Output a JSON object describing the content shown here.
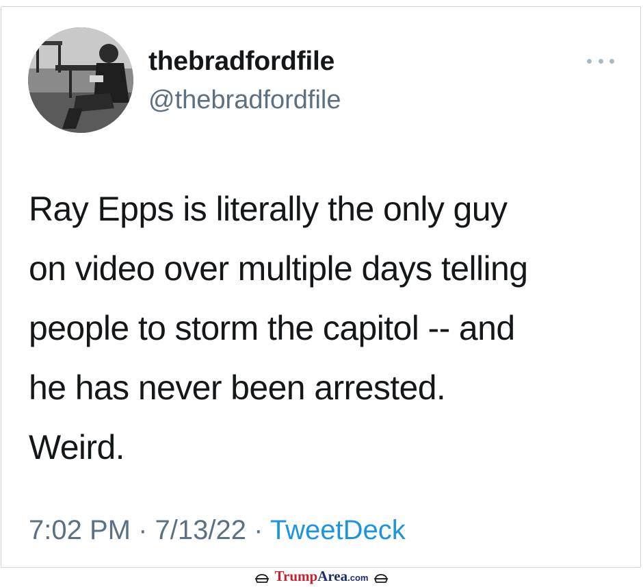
{
  "tweet": {
    "display_name": "thebradfordfile",
    "handle": "@thebradfordfile",
    "text": "Ray Epps is literally the only guy\non video over multiple days telling\npeople to storm the capitol -- and\nhe has never been arrested.\nWeird.",
    "time": "7:02 PM",
    "date": "7/13/22",
    "source": "TweetDeck",
    "separator": "·"
  },
  "icons": {
    "more": "more-horizontal-icon",
    "watermark_left": "hat-icon",
    "watermark_right": "hat-icon"
  },
  "watermark": {
    "brand_part1": "Trump",
    "brand_part2": "Area",
    "brand_part3": ".com"
  },
  "colors": {
    "handle": "#5b7083",
    "source_link": "#1b95e0",
    "text": "#14171a",
    "watermark_red": "#c8202c",
    "watermark_blue": "#1a2e6e"
  }
}
